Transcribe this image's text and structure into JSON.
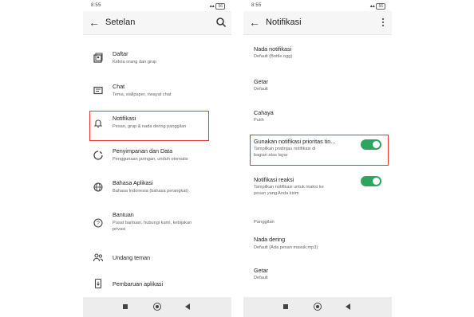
{
  "left_screen": {
    "status": {
      "time": "8:55",
      "battery": "56"
    },
    "app_title": "Setelan",
    "items": [
      {
        "title": "Daftar",
        "subtitle": "Kelola orang dan grup",
        "icon": "list-icon"
      },
      {
        "title": "Chat",
        "subtitle": "Tema, wallpaper, riwayat chat",
        "icon": "chat-icon"
      },
      {
        "title": "Notifikasi",
        "subtitle": "Pesan, grup & nada dering panggilan",
        "icon": "bell-icon"
      },
      {
        "title": "Penyimpanan dan Data",
        "subtitle": "Penggunaan jaringan, unduh otomatis",
        "icon": "storage-icon"
      },
      {
        "title": "Bahasa Aplikasi",
        "subtitle": "Bahasa Indonesia (bahasa perangkat)",
        "icon": "globe-icon"
      },
      {
        "title": "Bantuan",
        "subtitle_line1": "Pusat bantuan, hubungi kami, kebijakan",
        "subtitle_line2": "privasi",
        "icon": "help-icon"
      },
      {
        "title": "Undang teman",
        "icon": "people-icon"
      },
      {
        "title": "Pembaruan aplikasi",
        "icon": "phone-update-icon"
      }
    ]
  },
  "right_screen": {
    "status": {
      "time": "8:55",
      "battery": "56"
    },
    "app_title": "Notifikasi",
    "rows": [
      {
        "title": "Nada notifikasi",
        "subtitle": "Default (Bottle.ogg)"
      },
      {
        "title": "Getar",
        "subtitle": "Default"
      },
      {
        "title": "Cahaya",
        "subtitle": "Putih"
      },
      {
        "title": "Gunakan notifikasi prioritas tin...",
        "subtitle_line1": "Tampilkan pratinjau notifikasi di",
        "subtitle_line2": "bagian atas layar",
        "toggle_on": true
      },
      {
        "title": "Notifikasi reaksi",
        "subtitle_line1": "Tampilkan notifikasi untuk reaksi ke",
        "subtitle_line2": "pesan yang Anda kirim",
        "toggle_on": true
      }
    ],
    "section_header": "Panggilan",
    "call_rows": [
      {
        "title": "Nada dering",
        "subtitle": "Default (Ada pesan masuk.mp3)"
      },
      {
        "title": "Getar",
        "subtitle": "Default"
      }
    ]
  },
  "colors": {
    "toggle_on": "#2aa65e",
    "highlight": "#e53935"
  }
}
